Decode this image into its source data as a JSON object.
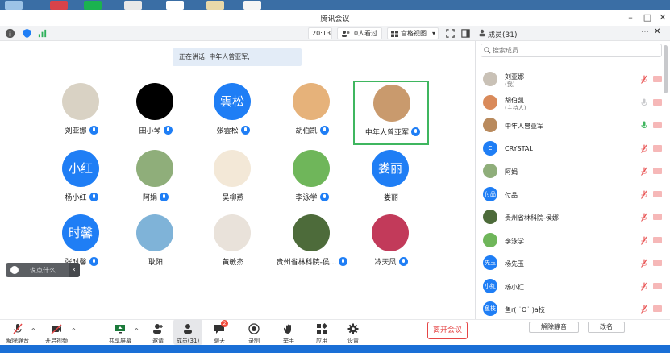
{
  "window": {
    "title": "腾讯会议",
    "controls": [
      "–",
      "□",
      "✕"
    ]
  },
  "toolbar": {
    "time": "20:13",
    "viewers": "0人看过",
    "view_mode": "宫格视图"
  },
  "speaking": "正在讲话: 中年人曾亚军;",
  "tiles": [
    {
      "name": "刘亚娜",
      "mic": true,
      "avatar": {
        "type": "photo",
        "color": "#d9d2c4"
      }
    },
    {
      "name": "田小琴",
      "mic": true,
      "avatar": {
        "type": "photo",
        "color": "#000000"
      }
    },
    {
      "name": "张雲松",
      "mic": true,
      "avatar": {
        "type": "text",
        "text": "雲松"
      }
    },
    {
      "name": "胡伯凯",
      "mic": true,
      "avatar": {
        "type": "photo",
        "color": "#e6b27a"
      }
    },
    {
      "name": "中年人曾亚军",
      "mic": true,
      "active": true,
      "avatar": {
        "type": "photo",
        "color": "#c99a6d"
      }
    },
    {
      "name": "杨小红",
      "mic": true,
      "avatar": {
        "type": "text",
        "text": "小红"
      }
    },
    {
      "name": "阿娟",
      "mic": true,
      "avatar": {
        "type": "photo",
        "color": "#8fae7a"
      }
    },
    {
      "name": "吴柳燕",
      "mic": false,
      "avatar": {
        "type": "photo",
        "color": "#f3e8d7"
      }
    },
    {
      "name": "李泳学",
      "mic": true,
      "avatar": {
        "type": "photo",
        "color": "#6fb65a"
      }
    },
    {
      "name": "娄丽",
      "mic": false,
      "avatar": {
        "type": "text",
        "text": "娄丽"
      }
    },
    {
      "name": "张时馨",
      "mic": true,
      "avatar": {
        "type": "text",
        "text": "时馨"
      }
    },
    {
      "name": "耿阳",
      "mic": false,
      "avatar": {
        "type": "photo",
        "color": "#7fb3d8"
      }
    },
    {
      "name": "黄敏杰",
      "mic": false,
      "avatar": {
        "type": "photo",
        "color": "#e9e2da"
      }
    },
    {
      "name": "贵州省林科院-侯...",
      "mic": true,
      "avatar": {
        "type": "photo",
        "color": "#4d6b3a"
      }
    },
    {
      "name": "冷天凤",
      "mic": true,
      "avatar": {
        "type": "photo",
        "color": "#c23a5a"
      }
    }
  ],
  "chat_placeholder": "说点什么...",
  "bottom": {
    "unmute": "解除静音",
    "video": "开启视频",
    "share": "共享屏幕",
    "invite": "邀请",
    "members": "成员(31)",
    "chat": "聊天",
    "chat_badge": "2",
    "record": "录制",
    "raise_hand": "举手",
    "apps": "应用",
    "settings": "设置",
    "leave": "离开会议"
  },
  "panel": {
    "title": "成员(31)",
    "search_placeholder": "搜索成员",
    "members": [
      {
        "name": "刘亚娜",
        "role": "(我)",
        "avatar": {
          "type": "photo",
          "color": "#c9c1b6"
        },
        "mic": "muted"
      },
      {
        "name": "胡伯凯",
        "role": "(主持人)",
        "avatar": {
          "type": "photo",
          "color": "#d98a5a"
        },
        "mic": "off"
      },
      {
        "name": "中年人曾亚军",
        "role": "",
        "avatar": {
          "type": "photo",
          "color": "#b98a5d"
        },
        "mic": "speaking"
      },
      {
        "name": "CRYSTAL",
        "role": "",
        "avatar": {
          "type": "text",
          "text": "C"
        },
        "mic": "muted"
      },
      {
        "name": "阿娟",
        "role": "",
        "avatar": {
          "type": "photo",
          "color": "#8fae7a"
        },
        "mic": "muted"
      },
      {
        "name": "付品",
        "role": "",
        "avatar": {
          "type": "text",
          "text": "付品"
        },
        "mic": "muted"
      },
      {
        "name": "贵州省林科院-侯娜",
        "role": "",
        "avatar": {
          "type": "photo",
          "color": "#4d6b3a"
        },
        "mic": "muted"
      },
      {
        "name": "李泳学",
        "role": "",
        "avatar": {
          "type": "photo",
          "color": "#6fb65a"
        },
        "mic": "muted"
      },
      {
        "name": "杨先玉",
        "role": "",
        "avatar": {
          "type": "text",
          "text": "先玉"
        },
        "mic": "muted"
      },
      {
        "name": "杨小红",
        "role": "",
        "avatar": {
          "type": "text",
          "text": "小红"
        },
        "mic": "muted"
      },
      {
        "name": "鱼r( ˙O˙ )a枝",
        "role": "",
        "avatar": {
          "type": "text",
          "text": "鱼枝"
        },
        "mic": "muted"
      }
    ],
    "footer": {
      "unmute_all": "解除静音",
      "rename": "改名"
    }
  },
  "colors": {
    "accent": "#1f7ef5",
    "active_border": "#3fb65f",
    "leave": "#e54545",
    "muted": "#f6b8b8"
  }
}
